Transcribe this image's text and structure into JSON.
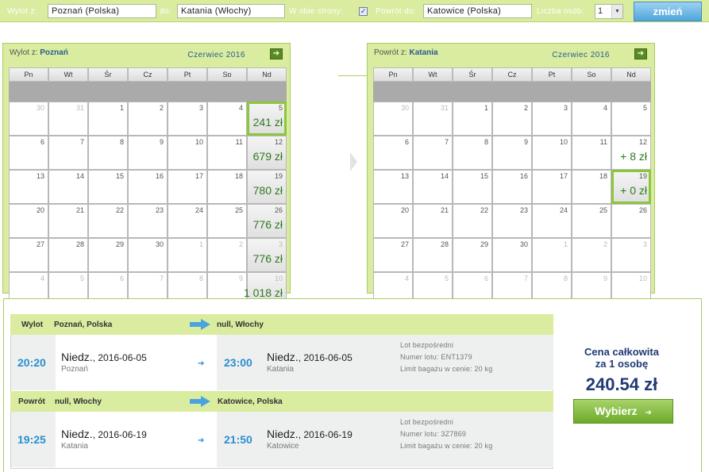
{
  "search": {
    "from_label": "Wylot z:",
    "from_value": "Poznań (Polska)",
    "to_label": "do:",
    "to_value": "Katania (Włochy)",
    "round_trip_label": "W obie strony:",
    "round_trip_checked": true,
    "return_label": "Powrót do:",
    "return_value": "Katowice (Polska)",
    "passengers_label": "Liczba osób:",
    "passengers_value": "1",
    "submit_label": "zmień"
  },
  "day_names": [
    "Pn",
    "Wt",
    "Śr",
    "Cz",
    "Pt",
    "So",
    "Nd"
  ],
  "outbound_calendar": {
    "title_label": "Wylot z:",
    "title_city": "Poznań",
    "month": "Czerwiec 2016",
    "cells": [
      {
        "d": "30",
        "out": true
      },
      {
        "d": "31",
        "out": true
      },
      {
        "d": "1"
      },
      {
        "d": "2"
      },
      {
        "d": "3"
      },
      {
        "d": "4"
      },
      {
        "d": "5",
        "price": "241 zł",
        "selected": true
      },
      {
        "d": "6"
      },
      {
        "d": "7"
      },
      {
        "d": "8"
      },
      {
        "d": "9"
      },
      {
        "d": "10"
      },
      {
        "d": "11"
      },
      {
        "d": "12",
        "price": "679 zł"
      },
      {
        "d": "13"
      },
      {
        "d": "14"
      },
      {
        "d": "15"
      },
      {
        "d": "16"
      },
      {
        "d": "17"
      },
      {
        "d": "18"
      },
      {
        "d": "19",
        "price": "780 zł"
      },
      {
        "d": "20"
      },
      {
        "d": "21"
      },
      {
        "d": "22"
      },
      {
        "d": "23"
      },
      {
        "d": "24"
      },
      {
        "d": "25"
      },
      {
        "d": "26",
        "price": "776 zł"
      },
      {
        "d": "27"
      },
      {
        "d": "28"
      },
      {
        "d": "29"
      },
      {
        "d": "30"
      },
      {
        "d": "1",
        "out": true
      },
      {
        "d": "2",
        "out": true
      },
      {
        "d": "3",
        "out": true,
        "price": "776 zł"
      },
      {
        "d": "4",
        "out": true
      },
      {
        "d": "5",
        "out": true
      },
      {
        "d": "6",
        "out": true
      },
      {
        "d": "7",
        "out": true
      },
      {
        "d": "8",
        "out": true
      },
      {
        "d": "9",
        "out": true
      },
      {
        "d": "10",
        "out": true,
        "price": "1 018 zł"
      }
    ]
  },
  "return_calendar": {
    "title_label": "Powrót z:",
    "title_city": "Katania",
    "month": "Czerwiec 2016",
    "cells": [
      {
        "d": "30",
        "out": true
      },
      {
        "d": "31",
        "out": true
      },
      {
        "d": "1"
      },
      {
        "d": "2"
      },
      {
        "d": "3"
      },
      {
        "d": "4"
      },
      {
        "d": "5"
      },
      {
        "d": "6"
      },
      {
        "d": "7"
      },
      {
        "d": "8"
      },
      {
        "d": "9"
      },
      {
        "d": "10"
      },
      {
        "d": "11"
      },
      {
        "d": "12",
        "price": "+ 8 zł",
        "white": true
      },
      {
        "d": "13"
      },
      {
        "d": "14"
      },
      {
        "d": "15"
      },
      {
        "d": "16"
      },
      {
        "d": "17"
      },
      {
        "d": "18"
      },
      {
        "d": "19",
        "price": "+ 0 zł",
        "selected": true
      },
      {
        "d": "20"
      },
      {
        "d": "21"
      },
      {
        "d": "22"
      },
      {
        "d": "23"
      },
      {
        "d": "24"
      },
      {
        "d": "25"
      },
      {
        "d": "26"
      },
      {
        "d": "27"
      },
      {
        "d": "28"
      },
      {
        "d": "29"
      },
      {
        "d": "30"
      },
      {
        "d": "1",
        "out": true
      },
      {
        "d": "2",
        "out": true
      },
      {
        "d": "3",
        "out": true
      },
      {
        "d": "4",
        "out": true
      },
      {
        "d": "5",
        "out": true
      },
      {
        "d": "6",
        "out": true
      },
      {
        "d": "7",
        "out": true
      },
      {
        "d": "8",
        "out": true
      },
      {
        "d": "9",
        "out": true
      },
      {
        "d": "10",
        "out": true
      }
    ]
  },
  "outbound": {
    "label": "Wylot",
    "from": "Poznań, Polska",
    "to": "null, Włochy",
    "dep_time": "20:20",
    "dep_day": "Niedz.",
    "dep_date": ", 2016-06-05",
    "dep_city": "Poznań",
    "arr_time": "23:00",
    "arr_day": "Niedz.",
    "arr_date": ", 2016-06-05",
    "arr_city": "Katania",
    "info1": "Lot bezpośredni",
    "info2": "Numer lotu: ENT1379",
    "info3": "Limit bagażu w cenie: 20 kg"
  },
  "return": {
    "label": "Powrót",
    "from": "null, Włochy",
    "to": "Katowice, Polska",
    "dep_time": "19:25",
    "dep_day": "Niedz.",
    "dep_date": ", 2016-06-19",
    "dep_city": "Katania",
    "arr_time": "21:50",
    "arr_day": "Niedz.",
    "arr_date": ", 2016-06-19",
    "arr_city": "Katowice",
    "info1": "Lot bezpośredni",
    "info2": "Numer lotu: 3Z7869",
    "info3": "Limit bagażu w cenie: 20 kg"
  },
  "price": {
    "total_line1": "Cena całkowita",
    "total_line2": "za 1 osobę",
    "amount": "240.54 zł",
    "select_label": "Wybierz",
    "arrow": "➔"
  },
  "colors": {
    "accent_green": "#8cc63e",
    "price_green": "#2f7a1e",
    "time_blue": "#2b8ed0",
    "panel_green": "#d9ec9f"
  }
}
